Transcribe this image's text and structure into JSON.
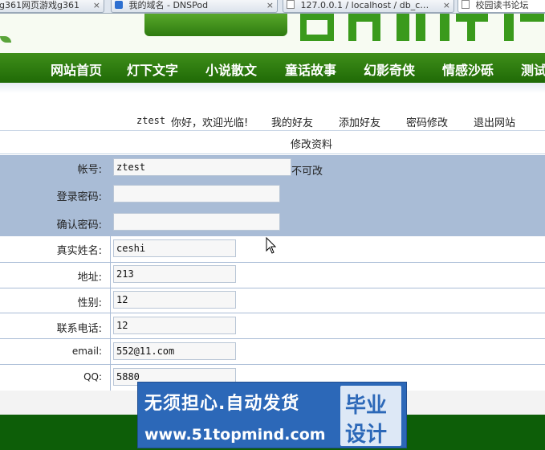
{
  "browser": {
    "tabs": [
      {
        "label": "g361网页游戏g361",
        "close": "×"
      },
      {
        "label": "我的域名 - DNSPod",
        "close": "×"
      },
      {
        "label": "127.0.0.1 / localhost / db_c…",
        "close": "×"
      },
      {
        "label": "校园读书论坛",
        "close": ""
      }
    ]
  },
  "nav": {
    "items": [
      "网站首页",
      "灯下文字",
      "小说散文",
      "童话故事",
      "幻影奇侠",
      "情感沙砾",
      "测试"
    ]
  },
  "userbar": {
    "username": "ztest",
    "welcome": "你好，欢迎光临!",
    "links": [
      "我的好友",
      "添加好友",
      "密码修改",
      "退出网站"
    ]
  },
  "form": {
    "title": "修改资料",
    "rows": [
      {
        "label": "帐号:",
        "value": "ztest",
        "note": "不可改"
      },
      {
        "label": "登录密码:",
        "value": ""
      },
      {
        "label": "确认密码:",
        "value": ""
      },
      {
        "label": "真实姓名:",
        "value": "ceshi"
      },
      {
        "label": "地址:",
        "value": "213"
      },
      {
        "label": "性别:",
        "value": "12"
      },
      {
        "label": "联系电话:",
        "value": "12"
      },
      {
        "label": "email:",
        "value": "552@11.com"
      },
      {
        "label": "QQ:",
        "value": "5880"
      }
    ]
  },
  "ad": {
    "line1": "无须担心.自动发货",
    "line2": "www.51topmind.com",
    "badge_top": "毕业",
    "badge_bottom": "设计"
  },
  "colors": {
    "nav_green": "#2a7a10",
    "band_blue": "#a9bcd6",
    "footer_green": "#0d5e08",
    "ad_blue": "#2c68b8"
  }
}
